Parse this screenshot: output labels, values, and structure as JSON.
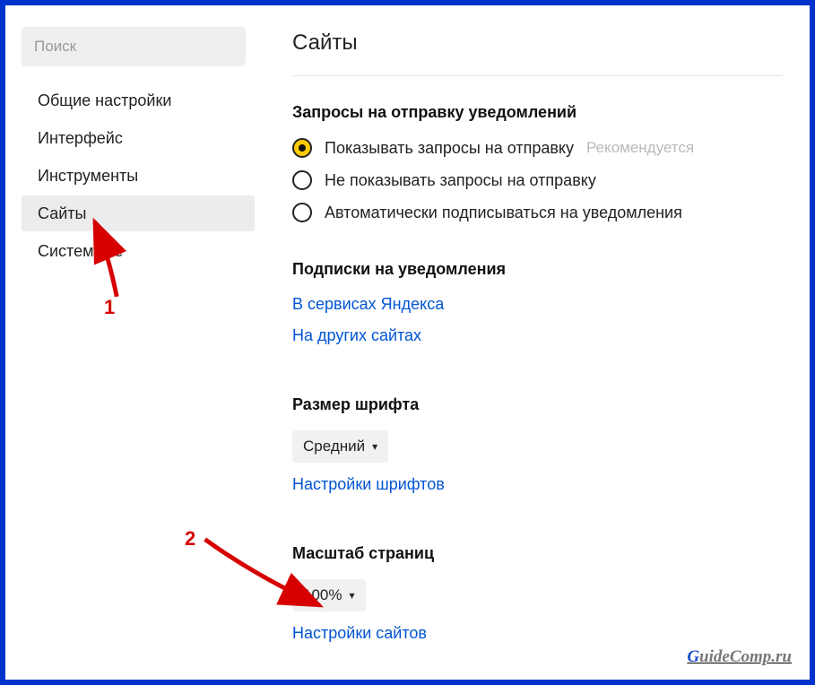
{
  "sidebar": {
    "search_placeholder": "Поиск",
    "items": [
      {
        "label": "Общие настройки"
      },
      {
        "label": "Интерфейс"
      },
      {
        "label": "Инструменты"
      },
      {
        "label": "Сайты",
        "selected": true
      },
      {
        "label": "Системные"
      }
    ]
  },
  "main": {
    "title": "Сайты",
    "notifications": {
      "heading": "Запросы на отправку уведомлений",
      "options": [
        {
          "label": "Показывать запросы на отправку",
          "selected": true,
          "recommended": "Рекомендуется"
        },
        {
          "label": "Не показывать запросы на отправку"
        },
        {
          "label": "Автоматически подписываться на уведомления"
        }
      ]
    },
    "subscriptions": {
      "heading": "Подписки на уведомления",
      "links": [
        "В сервисах Яндекса",
        "На других сайтах"
      ]
    },
    "font_size": {
      "heading": "Размер шрифта",
      "value": "Средний",
      "link": "Настройки шрифтов"
    },
    "page_scale": {
      "heading": "Масштаб страниц",
      "value": "100%",
      "link": "Настройки сайтов"
    }
  },
  "annotations": {
    "num1": "1",
    "num2": "2"
  },
  "watermark": {
    "first": "G",
    "rest": "uideComp.ru"
  }
}
